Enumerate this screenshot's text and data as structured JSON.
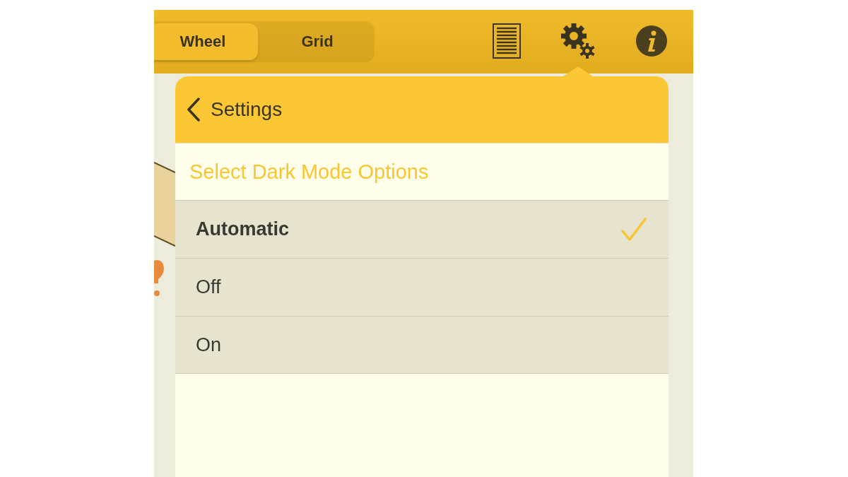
{
  "toolbar": {
    "segments": [
      {
        "label": "Wheel",
        "selected": true
      },
      {
        "label": "Grid",
        "selected": false
      }
    ]
  },
  "popover": {
    "back_label": "Settings",
    "section_title": "Select Dark Mode Options",
    "options": [
      {
        "label": "Automatic",
        "selected": true
      },
      {
        "label": "Off",
        "selected": false
      },
      {
        "label": "On",
        "selected": false
      }
    ]
  }
}
